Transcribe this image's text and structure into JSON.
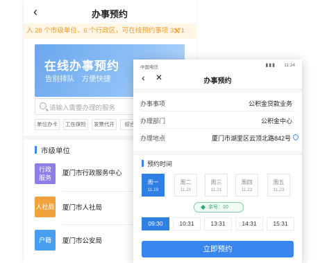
{
  "back": {
    "title": "办事预约",
    "notice": "入 28 个市级单位、6 个行政区，可在线预约事项 3371",
    "banner_title": "在线办事预约",
    "banner_sub": "告别排队　方便快捷",
    "search_placeholder": "请输入需要办理的服务",
    "tags": [
      "单位办卡",
      "工伤保险",
      "发票代开",
      "综合"
    ],
    "section_title": "市级单位",
    "orgs": [
      {
        "icon_text": "行政服务",
        "label": "厦门市行政服务中心",
        "color": "#8d7ee6"
      },
      {
        "icon_text": "人社局",
        "label": "厦门市人社局",
        "color": "#f2a23c"
      },
      {
        "icon_text": "户籍",
        "label": "厦门市公安局",
        "color": "#4a9ef2"
      }
    ]
  },
  "front": {
    "status_carrier": "中国电信",
    "status_time": "11:24",
    "title": "办事预约",
    "rows": [
      {
        "label": "办事事项",
        "value": "公积金贷款业务"
      },
      {
        "label": "办理部门",
        "value": "公积金中心"
      },
      {
        "label": "办理地点",
        "value": "厦门市湖里区云顶北路842号"
      }
    ],
    "section_title": "预约时间",
    "days": [
      {
        "day": "周一",
        "date": "11.19"
      },
      {
        "day": "周二",
        "date": "11.20"
      },
      {
        "day": "周三",
        "date": "11.21"
      },
      {
        "day": "周四",
        "date": "11.22"
      },
      {
        "day": "周五",
        "date": "11.23"
      }
    ],
    "remaining": "余号：10",
    "slots": [
      "09:30",
      "10:31",
      "13:31",
      "14:31",
      "15:31"
    ],
    "submit": "立即预约"
  },
  "colors": {
    "primary": "#2f7fe5",
    "notice": "#f19a2a",
    "green": "#2fa86a"
  }
}
